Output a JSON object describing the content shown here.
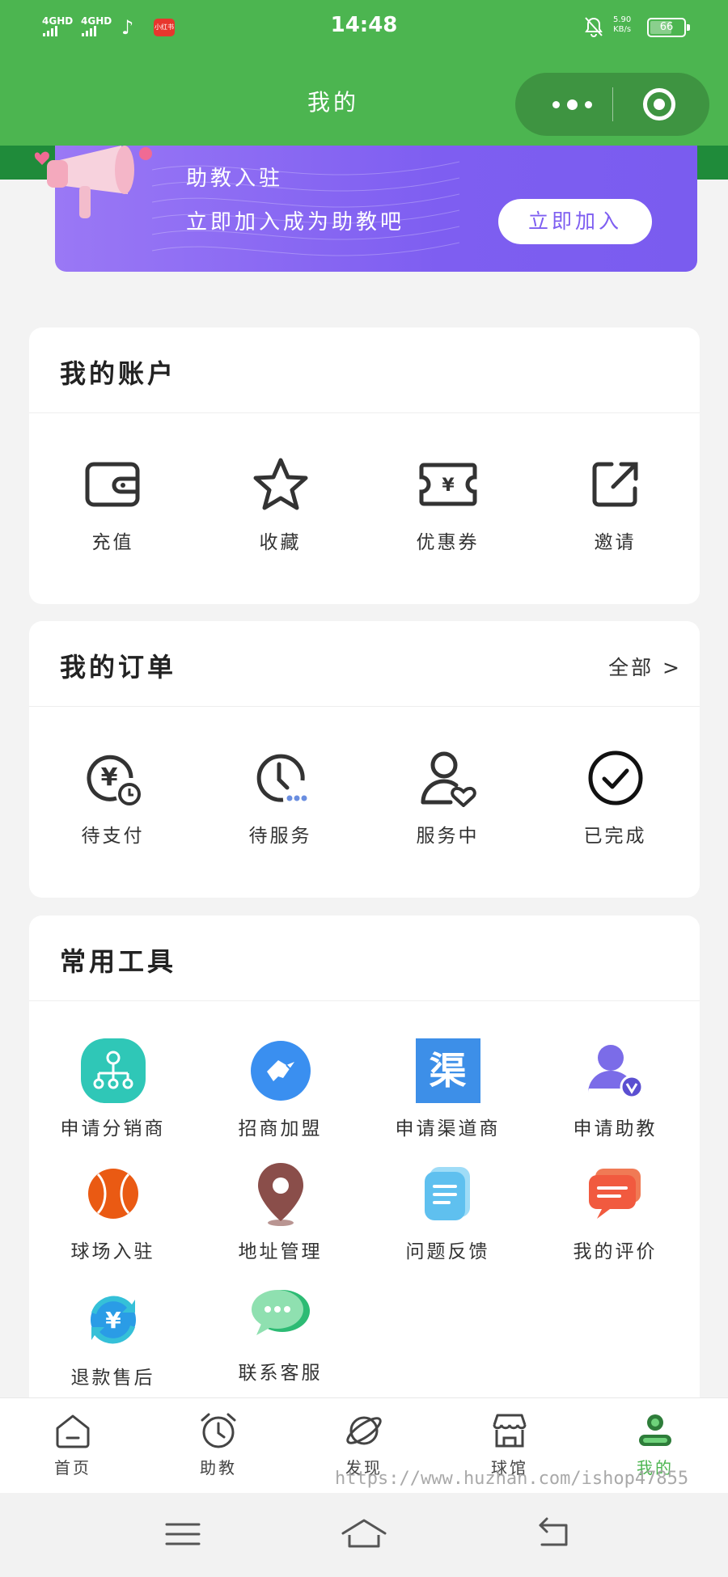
{
  "status_bar": {
    "time": "14:48",
    "signal_1": "4GHD",
    "signal_2": "4GHD",
    "red_app_label": "小红书",
    "net_speed": "5.90",
    "net_speed_unit": "KB/s",
    "battery": "66",
    "battery_level": 0.66
  },
  "nav": {
    "title": "我的"
  },
  "banner": {
    "line1": "助教入驻",
    "line2": "立即加入成为助教吧",
    "join_button": "立即加入"
  },
  "account": {
    "title": "我的账户",
    "items": [
      {
        "label": "充值",
        "icon": "wallet-icon"
      },
      {
        "label": "收藏",
        "icon": "star-icon"
      },
      {
        "label": "优惠券",
        "icon": "coupon-icon"
      },
      {
        "label": "邀请",
        "icon": "share-icon"
      }
    ]
  },
  "orders": {
    "title": "我的订单",
    "all_link": "全部 >",
    "items": [
      {
        "label": "待支付",
        "icon": "yen-clock-icon"
      },
      {
        "label": "待服务",
        "icon": "clock-icon"
      },
      {
        "label": "服务中",
        "icon": "user-heart-icon"
      },
      {
        "label": "已完成",
        "icon": "check-circle-icon"
      }
    ]
  },
  "tools": {
    "title": "常用工具",
    "items": [
      {
        "label": "申请分销商",
        "icon": "network-icon"
      },
      {
        "label": "招商加盟",
        "icon": "handshake-icon"
      },
      {
        "label": "申请渠道商",
        "icon": "channel-icon",
        "glyph": "渠"
      },
      {
        "label": "申请助教",
        "icon": "verified-user-icon"
      },
      {
        "label": "球场入驻",
        "icon": "ball-icon"
      },
      {
        "label": "地址管理",
        "icon": "location-pin-icon"
      },
      {
        "label": "问题反馈",
        "icon": "feedback-doc-icon"
      },
      {
        "label": "我的评价",
        "icon": "comment-icon"
      },
      {
        "label": "退款售后",
        "icon": "refund-icon"
      },
      {
        "label": "联系客服",
        "icon": "chat-icon"
      }
    ]
  },
  "tabbar": {
    "items": [
      {
        "label": "首页",
        "icon": "home-icon"
      },
      {
        "label": "助教",
        "icon": "alarm-clock-icon"
      },
      {
        "label": "发现",
        "icon": "planet-icon"
      },
      {
        "label": "球馆",
        "icon": "store-icon"
      },
      {
        "label": "我的",
        "icon": "profile-icon",
        "active": true
      }
    ]
  },
  "watermark": "https://www.huzhan.com/ishop47855",
  "colors": {
    "brand_green": "#4cb550",
    "banner_purple": "#7e5ef1"
  }
}
